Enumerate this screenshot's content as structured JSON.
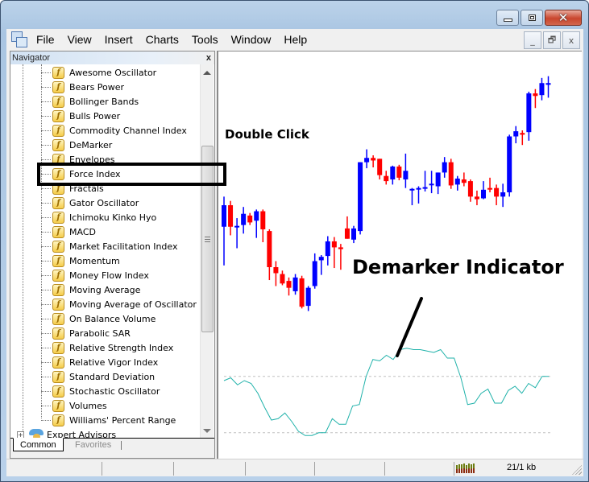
{
  "window": {
    "caption_buttons": [
      "minimize",
      "maximize",
      "close"
    ]
  },
  "menubar": {
    "app_icon": "metatrader-app-icon",
    "items": [
      "File",
      "View",
      "Insert",
      "Charts",
      "Tools",
      "Window",
      "Help"
    ],
    "mdi_buttons": [
      "_",
      "🗗",
      "x"
    ]
  },
  "navigator": {
    "title": "Navigator",
    "close_label": "x",
    "indicators": [
      "Awesome Oscillator",
      "Bears Power",
      "Bollinger Bands",
      "Bulls Power",
      "Commodity Channel Index",
      "DeMarker",
      "Envelopes",
      "Force Index",
      "Fractals",
      "Gator Oscillator",
      "Ichimoku Kinko Hyo",
      "MACD",
      "Market Facilitation Index",
      "Momentum",
      "Money Flow Index",
      "Moving Average",
      "Moving Average of Oscillator",
      "On Balance Volume",
      "Parabolic SAR",
      "Relative Strength Index",
      "Relative Vigor Index",
      "Standard Deviation",
      "Stochastic Oscillator",
      "Volumes",
      "Williams' Percent Range"
    ],
    "indicator_icon_glyph": "f",
    "highlighted_item": "DeMarker",
    "expert_advisors": {
      "label": "Expert Advisors",
      "expand_glyph": "+"
    },
    "tabs": [
      {
        "label": "Common",
        "active": true
      },
      {
        "label": "Favorites",
        "active": false
      }
    ]
  },
  "annotations": {
    "double_click": "Double Click",
    "indicator_label": "Demarker Indicator"
  },
  "colors": {
    "bull_candle": "#0000ff",
    "bear_candle": "#ff0000",
    "indicator_line": "#20b2aa",
    "level_line": "#c0c0c0",
    "annotation": "#000000"
  },
  "chart_data": {
    "type": "candlestick",
    "candles": [
      {
        "o": 1.3555,
        "h": 1.359,
        "l": 1.351,
        "c": 1.358,
        "dir": "up"
      },
      {
        "o": 1.358,
        "h": 1.3585,
        "l": 1.3545,
        "c": 1.3555,
        "dir": "down"
      },
      {
        "o": 1.3555,
        "h": 1.3565,
        "l": 1.353,
        "c": 1.3556,
        "dir": "up"
      },
      {
        "o": 1.3557,
        "h": 1.3578,
        "l": 1.3547,
        "c": 1.357,
        "dir": "up"
      },
      {
        "o": 1.3568,
        "h": 1.3571,
        "l": 1.3557,
        "c": 1.356,
        "dir": "down"
      },
      {
        "o": 1.3562,
        "h": 1.3575,
        "l": 1.3542,
        "c": 1.3573,
        "dir": "up"
      },
      {
        "o": 1.3573,
        "h": 1.3575,
        "l": 1.3537,
        "c": 1.3552,
        "dir": "down"
      },
      {
        "o": 1.355,
        "h": 1.3552,
        "l": 1.3493,
        "c": 1.3508,
        "dir": "down"
      },
      {
        "o": 1.3508,
        "h": 1.3515,
        "l": 1.3486,
        "c": 1.3501,
        "dir": "down"
      },
      {
        "o": 1.35,
        "h": 1.3504,
        "l": 1.3487,
        "c": 1.3489,
        "dir": "down"
      },
      {
        "o": 1.3492,
        "h": 1.3496,
        "l": 1.3475,
        "c": 1.3484,
        "dir": "down"
      },
      {
        "o": 1.348,
        "h": 1.35,
        "l": 1.3476,
        "c": 1.3496,
        "dir": "up"
      },
      {
        "o": 1.3495,
        "h": 1.3498,
        "l": 1.346,
        "c": 1.3462,
        "dir": "down"
      },
      {
        "o": 1.3463,
        "h": 1.3486,
        "l": 1.3457,
        "c": 1.3484,
        "dir": "up"
      },
      {
        "o": 1.3486,
        "h": 1.3524,
        "l": 1.3483,
        "c": 1.3515,
        "dir": "up"
      },
      {
        "o": 1.3516,
        "h": 1.3522,
        "l": 1.3499,
        "c": 1.352,
        "dir": "up"
      },
      {
        "o": 1.3521,
        "h": 1.3544,
        "l": 1.351,
        "c": 1.3538,
        "dir": "up"
      },
      {
        "o": 1.3538,
        "h": 1.3543,
        "l": 1.3507,
        "c": 1.3531,
        "dir": "down"
      },
      {
        "o": 1.3531,
        "h": 1.3535,
        "l": 1.3505,
        "c": 1.3529,
        "dir": "down"
      },
      {
        "o": 1.3553,
        "h": 1.3567,
        "l": 1.3543,
        "c": 1.3541,
        "dir": "down"
      },
      {
        "o": 1.354,
        "h": 1.3556,
        "l": 1.3536,
        "c": 1.3553,
        "dir": "up"
      },
      {
        "o": 1.355,
        "h": 1.3602,
        "l": 1.3546,
        "c": 1.363,
        "dir": "up"
      },
      {
        "o": 1.363,
        "h": 1.3645,
        "l": 1.3623,
        "c": 1.3635,
        "dir": "up"
      },
      {
        "o": 1.3635,
        "h": 1.3638,
        "l": 1.3624,
        "c": 1.3632,
        "dir": "down"
      },
      {
        "o": 1.3634,
        "h": 1.3634,
        "l": 1.361,
        "c": 1.3615,
        "dir": "down"
      },
      {
        "o": 1.3614,
        "h": 1.362,
        "l": 1.3604,
        "c": 1.3608,
        "dir": "down"
      },
      {
        "o": 1.361,
        "h": 1.3626,
        "l": 1.3604,
        "c": 1.3625,
        "dir": "up"
      },
      {
        "o": 1.3625,
        "h": 1.3627,
        "l": 1.3609,
        "c": 1.3612,
        "dir": "down"
      },
      {
        "o": 1.361,
        "h": 1.364,
        "l": 1.36,
        "c": 1.362,
        "dir": "up"
      },
      {
        "o": 1.3598,
        "h": 1.36,
        "l": 1.358,
        "c": 1.3599,
        "dir": "up"
      },
      {
        "o": 1.36,
        "h": 1.3602,
        "l": 1.3582,
        "c": 1.36,
        "dir": "up"
      },
      {
        "o": 1.3601,
        "h": 1.362,
        "l": 1.3596,
        "c": 1.3601,
        "dir": "up"
      },
      {
        "o": 1.3605,
        "h": 1.362,
        "l": 1.3594,
        "c": 1.3605,
        "dir": "up"
      },
      {
        "o": 1.3602,
        "h": 1.3606,
        "l": 1.3593,
        "c": 1.3618,
        "dir": "up"
      },
      {
        "o": 1.3618,
        "h": 1.3636,
        "l": 1.3612,
        "c": 1.363,
        "dir": "up"
      },
      {
        "o": 1.363,
        "h": 1.3634,
        "l": 1.3599,
        "c": 1.3603,
        "dir": "down"
      },
      {
        "o": 1.3604,
        "h": 1.3614,
        "l": 1.3597,
        "c": 1.3611,
        "dir": "up"
      },
      {
        "o": 1.361,
        "h": 1.3618,
        "l": 1.3602,
        "c": 1.3606,
        "dir": "down"
      },
      {
        "o": 1.3608,
        "h": 1.361,
        "l": 1.3584,
        "c": 1.359,
        "dir": "down"
      },
      {
        "o": 1.359,
        "h": 1.3597,
        "l": 1.358,
        "c": 1.3587,
        "dir": "down"
      },
      {
        "o": 1.3588,
        "h": 1.3608,
        "l": 1.3587,
        "c": 1.3598,
        "dir": "up"
      },
      {
        "o": 1.36,
        "h": 1.3612,
        "l": 1.3595,
        "c": 1.36,
        "dir": "down"
      },
      {
        "o": 1.36,
        "h": 1.3604,
        "l": 1.358,
        "c": 1.359,
        "dir": "down"
      },
      {
        "o": 1.359,
        "h": 1.3605,
        "l": 1.3578,
        "c": 1.3595,
        "dir": "up"
      },
      {
        "o": 1.3595,
        "h": 1.3662,
        "l": 1.359,
        "c": 1.366,
        "dir": "up"
      },
      {
        "o": 1.366,
        "h": 1.3672,
        "l": 1.3652,
        "c": 1.3666,
        "dir": "up"
      },
      {
        "o": 1.3664,
        "h": 1.3667,
        "l": 1.365,
        "c": 1.3662,
        "dir": "down"
      },
      {
        "o": 1.3665,
        "h": 1.3712,
        "l": 1.3655,
        "c": 1.371,
        "dir": "up"
      },
      {
        "o": 1.371,
        "h": 1.3715,
        "l": 1.3693,
        "c": 1.3707,
        "dir": "down"
      },
      {
        "o": 1.3708,
        "h": 1.3728,
        "l": 1.3702,
        "c": 1.3722,
        "dir": "up"
      },
      {
        "o": 1.372,
        "h": 1.373,
        "l": 1.3705,
        "c": 1.3722,
        "dir": "up"
      }
    ],
    "price_range": [
      1.345,
      1.374
    ],
    "indicator": {
      "name": "DeMarker",
      "levels": [
        0.3,
        0.7
      ],
      "range": [
        0.15,
        0.95
      ],
      "values": [
        0.67,
        0.69,
        0.64,
        0.67,
        0.65,
        0.58,
        0.48,
        0.39,
        0.4,
        0.44,
        0.38,
        0.31,
        0.28,
        0.28,
        0.3,
        0.3,
        0.4,
        0.36,
        0.36,
        0.49,
        0.5,
        0.7,
        0.82,
        0.81,
        0.85,
        0.82,
        0.89,
        0.9,
        0.89,
        0.89,
        0.88,
        0.87,
        0.89,
        0.83,
        0.83,
        0.69,
        0.5,
        0.51,
        0.58,
        0.61,
        0.51,
        0.51,
        0.6,
        0.63,
        0.58,
        0.65,
        0.62,
        0.7,
        0.7
      ]
    },
    "title": "",
    "xlabel": "",
    "ylabel": ""
  },
  "statusbar": {
    "traffic": "21/1 kb",
    "connection_icon": "connection-bars-icon"
  }
}
